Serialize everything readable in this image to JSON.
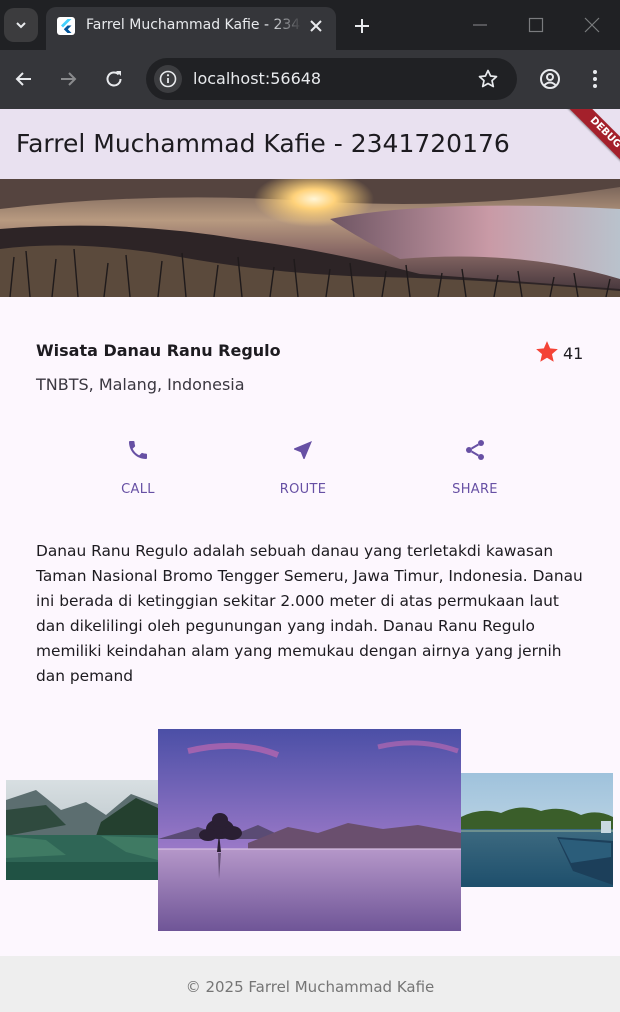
{
  "browser": {
    "tab_title": "Farrel Muchammad Kafie - 2341720176",
    "url": "localhost:56648"
  },
  "app": {
    "title": "Farrel Muchammad Kafie - 2341720176",
    "debug_banner": "DEBUG"
  },
  "place": {
    "name": "Wisata Danau Ranu Regulo",
    "location": "TNBTS, Malang, Indonesia",
    "rating": "41"
  },
  "actions": [
    {
      "label": "CALL",
      "icon": "phone-icon"
    },
    {
      "label": "ROUTE",
      "icon": "navigation-icon"
    },
    {
      "label": "SHARE",
      "icon": "share-icon"
    }
  ],
  "description": "Danau Ranu Regulo adalah sebuah danau yang terletakdi kawasan Taman Nasional Bromo Tengger Semeru, Jawa Timur, Indonesia. Danau ini berada di ketinggian sekitar 2.000 meter di atas permukaan laut dan dikelilingi oleh pegunungan yang indah. Danau Ranu Regulo memiliki keindahan alam yang memukau dengan airnya yang jernih dan pemand",
  "footer": "© 2025 Farrel Muchammad Kafie",
  "colors": {
    "accent": "#6750a4",
    "star": "#f44336",
    "appbar": "#e9e1f0",
    "background": "#fdf7fe"
  }
}
